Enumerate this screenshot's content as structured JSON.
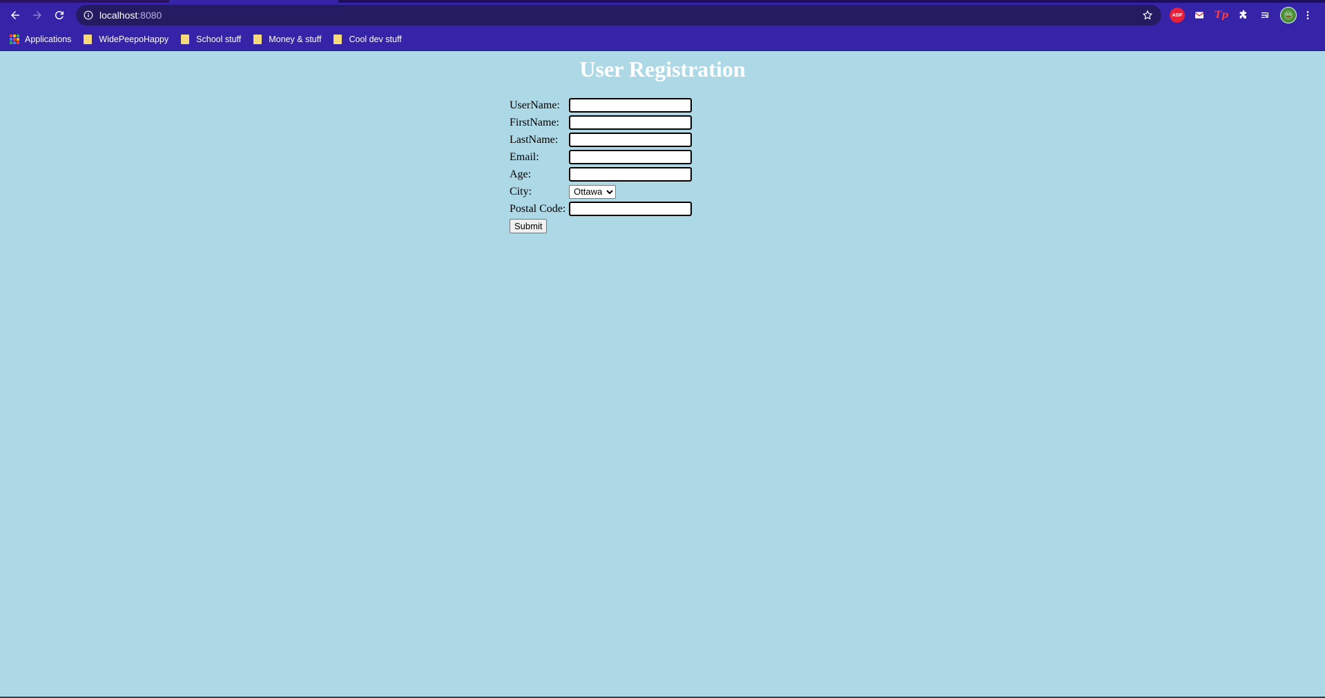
{
  "browser": {
    "url_host": "localhost",
    "url_port": ":8080",
    "bookmarks": [
      {
        "label": "Applications",
        "icon": "apps-icon"
      },
      {
        "label": "WidePeepoHappy",
        "icon": "folder-icon"
      },
      {
        "label": "School stuff",
        "icon": "folder-icon"
      },
      {
        "label": "Money & stuff",
        "icon": "folder-icon"
      },
      {
        "label": "Cool dev stuff",
        "icon": "folder-icon"
      }
    ],
    "extensions": {
      "abp": "ABP",
      "tp": "Tp"
    },
    "colors": {
      "toolbar": "#3523a8",
      "omnibox": "#241b63",
      "page_background": "#add8e6"
    }
  },
  "page": {
    "title": "User Registration",
    "fields": {
      "username": {
        "label": "UserName:",
        "value": ""
      },
      "firstname": {
        "label": "FirstName:",
        "value": ""
      },
      "lastname": {
        "label": "LastName:",
        "value": ""
      },
      "email": {
        "label": "Email:",
        "value": ""
      },
      "age": {
        "label": "Age:",
        "value": ""
      },
      "city": {
        "label": "City:",
        "selected": "Ottawa"
      },
      "postal": {
        "label": "Postal Code:",
        "value": ""
      }
    },
    "submit_label": "Submit"
  }
}
